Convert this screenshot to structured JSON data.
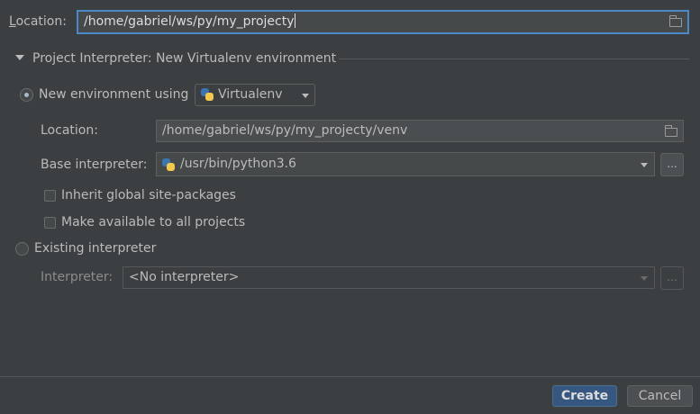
{
  "top": {
    "location_label": "Location:",
    "location_value": "/home/gabriel/ws/py/my_projecty"
  },
  "section": {
    "title": "Project Interpreter: New Virtualenv environment"
  },
  "new_env": {
    "label": "New environment using",
    "tool": "Virtualenv",
    "location_label": "Location:",
    "location_value": "/home/gabriel/ws/py/my_projecty/venv",
    "base_label": "Base interpreter:",
    "base_value": "/usr/bin/python3.6",
    "browse": "...",
    "inherit_label": "Inherit global site-packages",
    "make_available_label": "Make available to all projects"
  },
  "existing": {
    "label": "Existing interpreter",
    "interpreter_label": "Interpreter:",
    "interpreter_value": "<No interpreter>",
    "browse": "..."
  },
  "footer": {
    "create": "Create",
    "cancel": "Cancel"
  },
  "colors": {
    "background": "#3c3f41",
    "accent": "#4a88c7",
    "primary_button": "#365880",
    "text": "#bbbbbb"
  },
  "icons": {
    "folder": "folder-icon",
    "python": "python-icon",
    "triangle": "expand-triangle-icon",
    "dropdown": "chevron-down-icon"
  }
}
